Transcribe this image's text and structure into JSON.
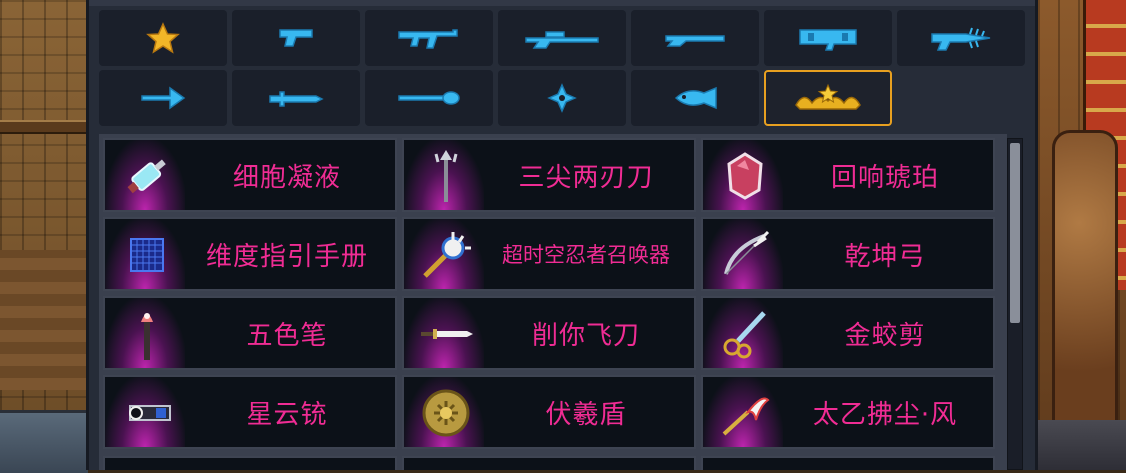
{
  "colors": {
    "panel_bg": "#262c38",
    "button_bg": "#1a1f2a",
    "selected_border": "#e8a020",
    "weapon_icon": "#38b8f0",
    "item_name": "#f02c94",
    "item_glow": "#d828c8"
  },
  "categories": [
    {
      "icon": "star-icon",
      "selected": false
    },
    {
      "icon": "pistol-icon",
      "selected": false
    },
    {
      "icon": "assault-rifle-icon",
      "selected": false
    },
    {
      "icon": "sniper-rifle-icon",
      "selected": false
    },
    {
      "icon": "shotgun-icon",
      "selected": false
    },
    {
      "icon": "rocket-launcher-icon",
      "selected": false
    },
    {
      "icon": "drill-gun-icon",
      "selected": false
    },
    {
      "icon": "bow-arrow-icon",
      "selected": false
    },
    {
      "icon": "sword-icon",
      "selected": false
    },
    {
      "icon": "staff-icon",
      "selected": false
    },
    {
      "icon": "shuriken-icon",
      "selected": false
    },
    {
      "icon": "fish-icon",
      "selected": false
    },
    {
      "icon": "special-stars-icon",
      "selected": true
    }
  ],
  "items": [
    {
      "name": "细胞凝液",
      "icon": "syringe-icon"
    },
    {
      "name": "三尖两刃刀",
      "icon": "trident-icon"
    },
    {
      "name": "回响琥珀",
      "icon": "amber-gem-icon"
    },
    {
      "name": "维度指引手册",
      "icon": "manual-icon"
    },
    {
      "name": "超时空忍者召唤器",
      "icon": "summoner-icon"
    },
    {
      "name": "乾坤弓",
      "icon": "bow-icon"
    },
    {
      "name": "五色笔",
      "icon": "brush-icon"
    },
    {
      "name": "削你飞刀",
      "icon": "throwing-knife-icon"
    },
    {
      "name": "金蛟剪",
      "icon": "golden-scissors-icon"
    },
    {
      "name": "星云铳",
      "icon": "nebula-gun-icon"
    },
    {
      "name": "伏羲盾",
      "icon": "shield-icon"
    },
    {
      "name": "太乙拂尘·风",
      "icon": "whisk-icon"
    }
  ]
}
